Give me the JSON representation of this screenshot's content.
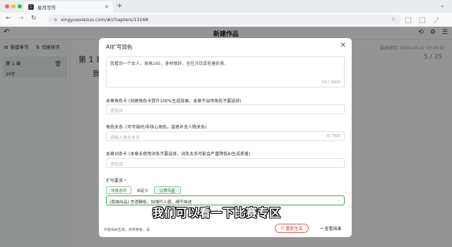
{
  "browser": {
    "tab_title": "星月写作",
    "tab_icon": "C",
    "url": "xingyuexiezuo.com/#/chapters/13168",
    "overlay_text": "ロ ロ ノ"
  },
  "app": {
    "title": "新建作品",
    "toolbar": {
      "new_chapter": "新建章节",
      "toggle_sort": "切换排序"
    },
    "chapters": [
      {
        "name": "第 1 章",
        "words": "29字"
      }
    ],
    "saved": "最后保存: 2024-10-22 10:26:43",
    "count": "5 / 35",
    "editor_title": "第 1 章",
    "editor_body": "我"
  },
  "modal": {
    "title": "AI扩写润色",
    "content": {
      "value": "我看到一个女人，身高165，身材很好，坐在冷饮店吃着奶茶.",
      "counter": "29 / 2500"
    },
    "role_card": {
      "label": "本章角色卡 (创建角色卡提升100%生成效果，本章不出场角色不要选择)",
      "placeholder": "请选择"
    },
    "relation": {
      "label": "角色关系: (可写临时/非核心角色，或者补充人物关系)",
      "placeholder": "请输入角色关系",
      "counter": "0 / 500"
    },
    "term_card": {
      "label": "本章词条卡 (本章未使用词条不要选择，词条太多可能会严重降低AI生成质量)",
      "placeholder": "请选择"
    },
    "requirement": {
      "label": "扩写要求",
      "required_mark": "*",
      "tabs": [
        "快捷选项",
        "自定义",
        "比赛专区"
      ],
      "selected": "(南城出品) 言语精练、加强代入感、细节描述"
    },
    "disclaimer": "内容由AI生成，仅供参考。请",
    "regenerate": "重新生成",
    "view_result": "查看结果"
  },
  "caption": "我们可以看一下比赛专区",
  "colors": {
    "accent_green": "#3fa45a",
    "danger_red": "#d9393e",
    "overlay": "#000000"
  }
}
